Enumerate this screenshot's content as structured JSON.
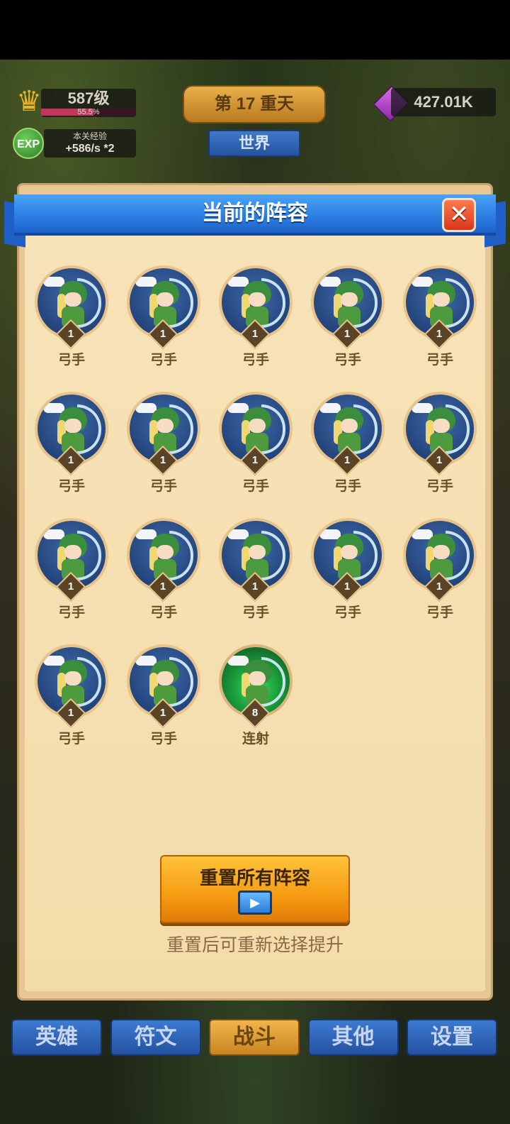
{
  "hud": {
    "level": "587级",
    "level_progress_text": "55.5%",
    "level_progress": 0.555,
    "exp_badge": "EXP",
    "exp_title": "本关经验",
    "exp_rate": "+586/s *2",
    "stage": "第 17 重天",
    "world_button": "世界",
    "gems": "427.01K",
    "icons": {
      "crown": "crown-icon",
      "gem": "gem-icon"
    }
  },
  "panel": {
    "title": "当前的阵容",
    "close_symbol": "✕",
    "units": [
      {
        "name": "弓手",
        "level": "1"
      },
      {
        "name": "弓手",
        "level": "1"
      },
      {
        "name": "弓手",
        "level": "1"
      },
      {
        "name": "弓手",
        "level": "1"
      },
      {
        "name": "弓手",
        "level": "1"
      },
      {
        "name": "弓手",
        "level": "1"
      },
      {
        "name": "弓手",
        "level": "1"
      },
      {
        "name": "弓手",
        "level": "1"
      },
      {
        "name": "弓手",
        "level": "1"
      },
      {
        "name": "弓手",
        "level": "1"
      },
      {
        "name": "弓手",
        "level": "1"
      },
      {
        "name": "弓手",
        "level": "1"
      },
      {
        "name": "弓手",
        "level": "1"
      },
      {
        "name": "弓手",
        "level": "1"
      },
      {
        "name": "弓手",
        "level": "1"
      },
      {
        "name": "弓手",
        "level": "1"
      },
      {
        "name": "弓手",
        "level": "1"
      },
      {
        "name": "连射",
        "level": "8",
        "special": true
      }
    ],
    "reset_button": "重置所有阵容",
    "video_symbol": "▶",
    "reset_note": "重置后可重新选择提升"
  },
  "nav": [
    {
      "label": "英雄"
    },
    {
      "label": "符文"
    },
    {
      "label": "战斗",
      "active": true
    },
    {
      "label": "其他"
    },
    {
      "label": "设置"
    }
  ],
  "colors": {
    "ribbon": "#2b7fe3",
    "close": "#d9361c",
    "reset": "#f59b12",
    "nav": "#2452a1",
    "nav_active": "#c98522"
  }
}
